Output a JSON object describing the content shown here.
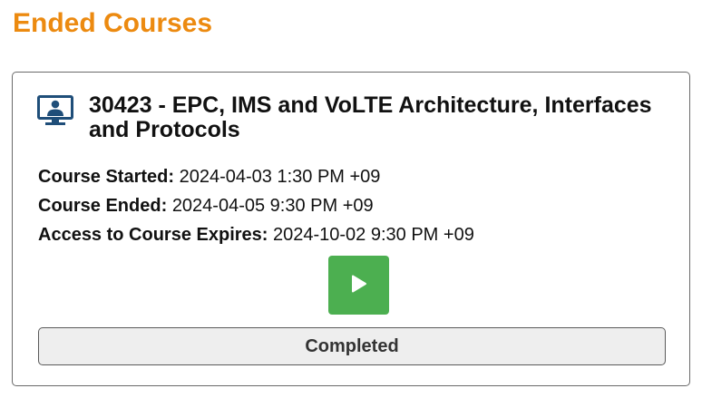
{
  "section": {
    "title": "Ended Courses"
  },
  "course": {
    "icon": "monitor-user-icon",
    "title": "30423 - EPC, IMS and VoLTE Architecture, Interfaces and Protocols",
    "started_label": "Course Started:",
    "started_value": "2024-04-03 1:30 PM +09",
    "ended_label": "Course Ended:",
    "ended_value": "2024-04-05 9:30 PM +09",
    "expires_label": "Access to Course Expires:",
    "expires_value": "2024-10-02 9:30 PM +09",
    "play_icon": "play-icon",
    "status_label": "Completed"
  },
  "colors": {
    "section_title": "#ec8a10",
    "icon": "#1f4e79",
    "play_button": "#4caf50",
    "status_button_bg": "#eeeeee"
  }
}
